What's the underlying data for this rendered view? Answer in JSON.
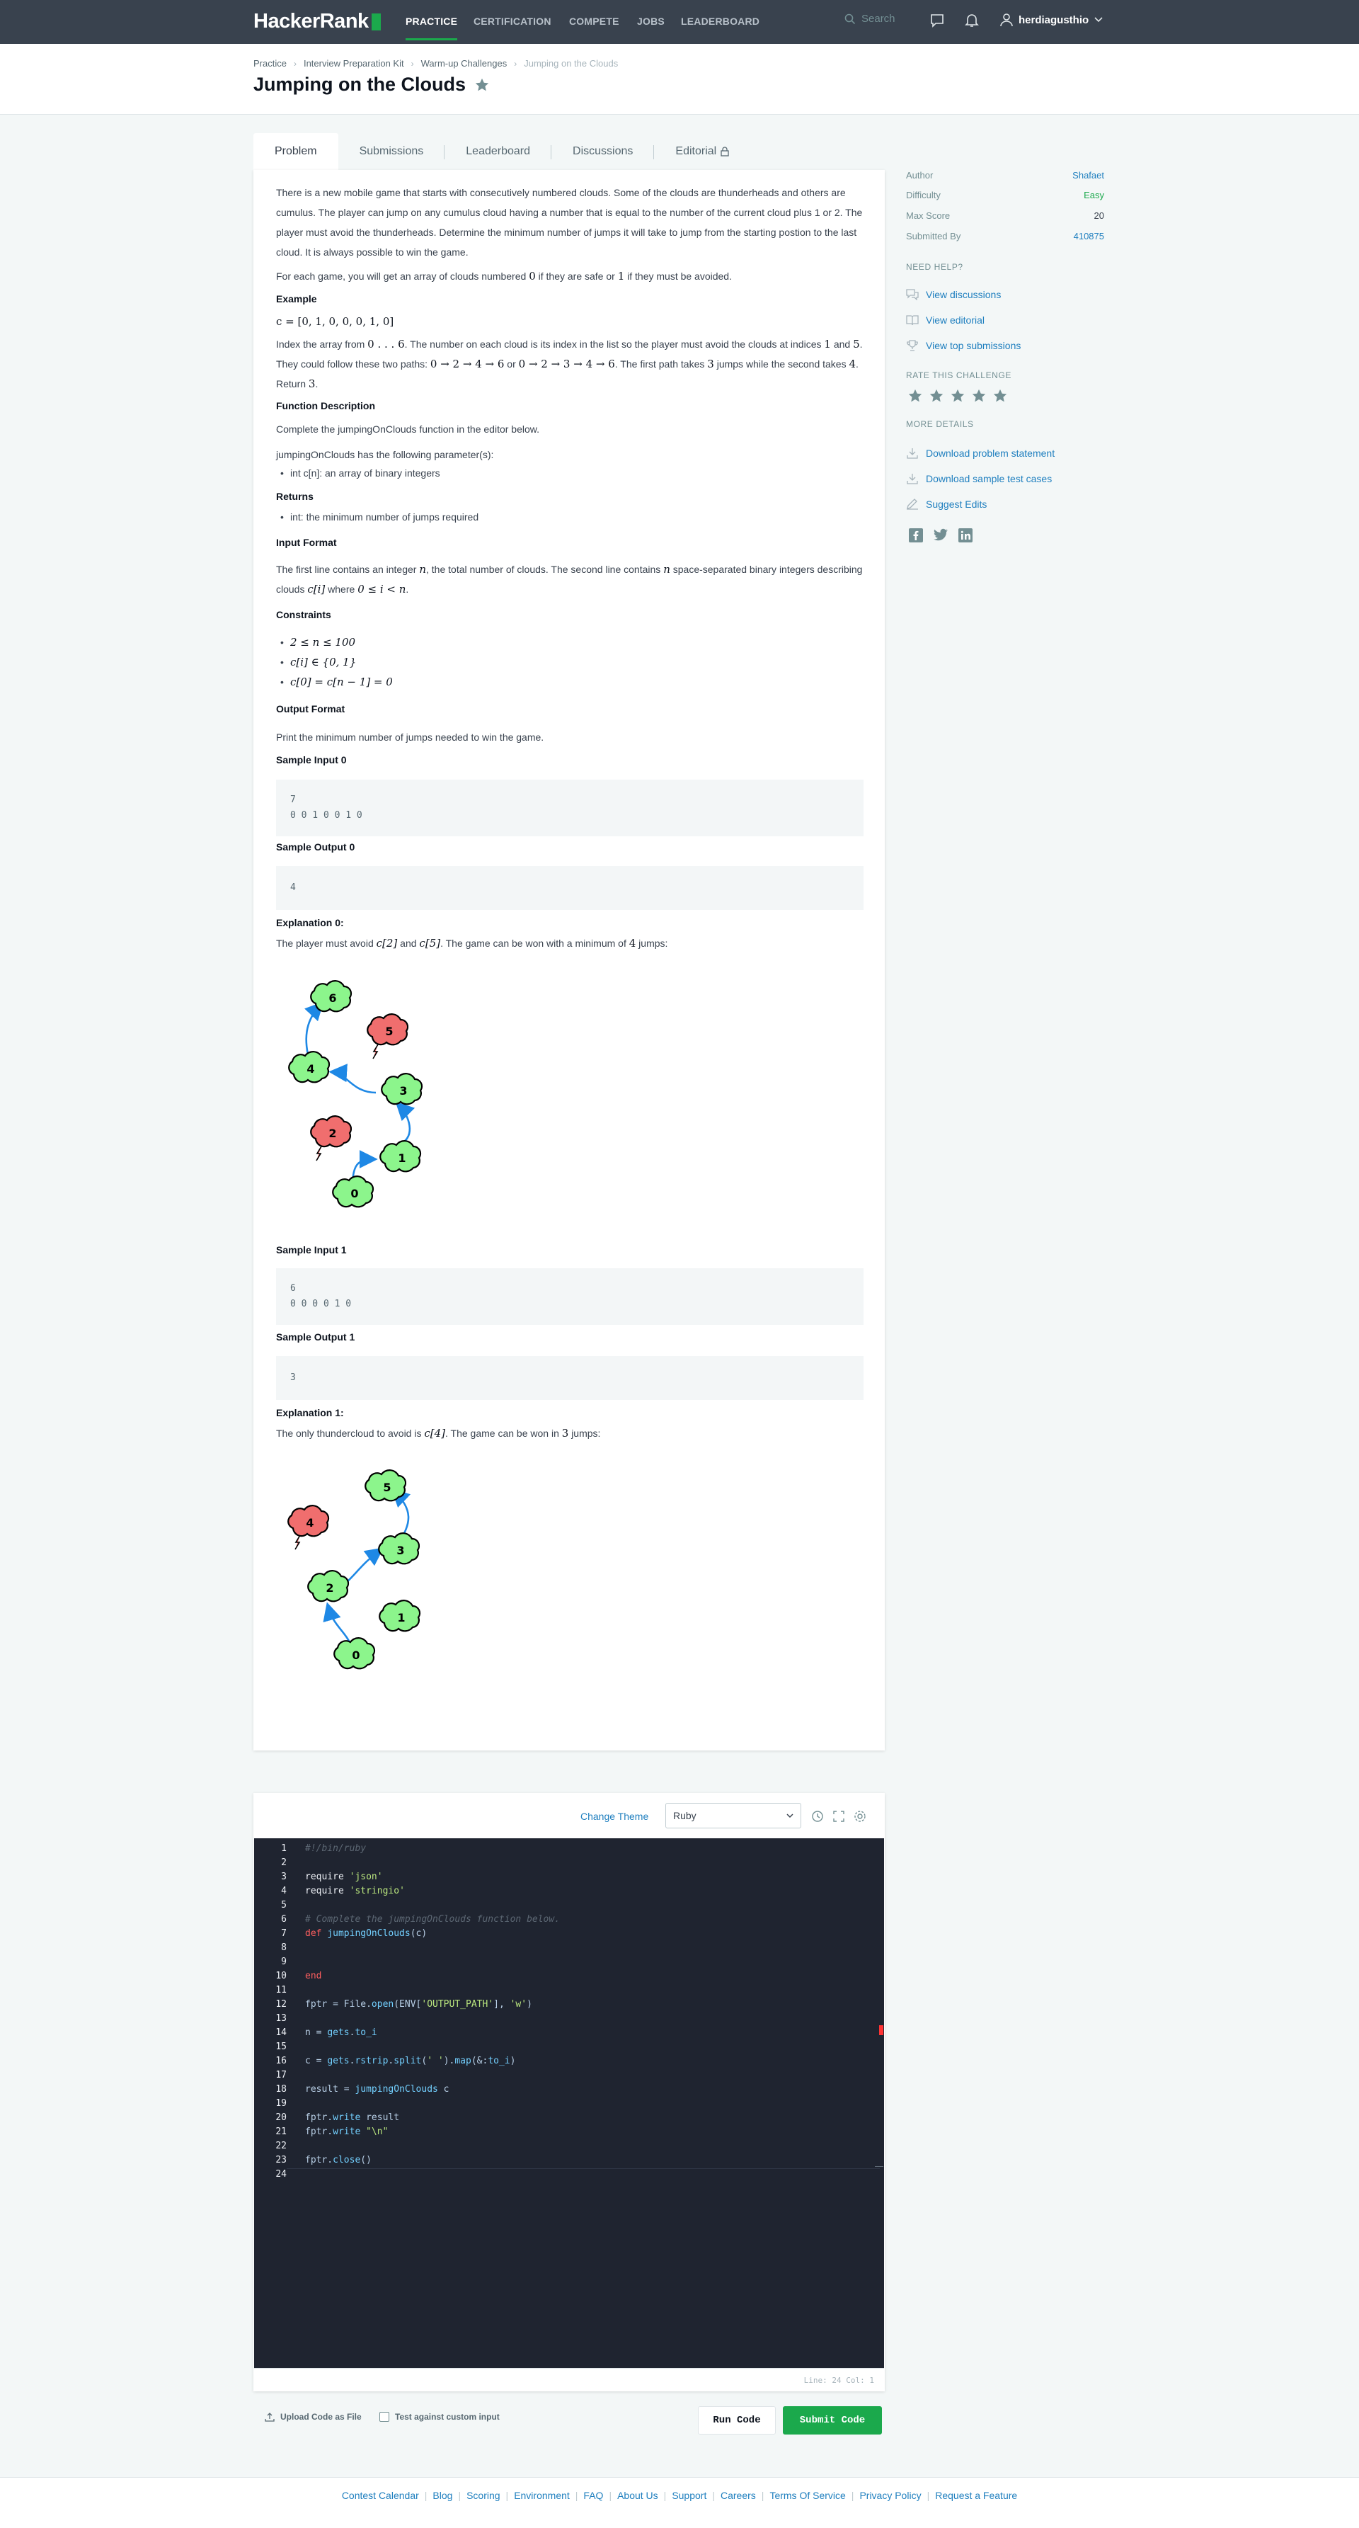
{
  "nav": {
    "logo": "HackerRank",
    "links": [
      "PRACTICE",
      "CERTIFICATION",
      "COMPETE",
      "JOBS",
      "LEADERBOARD"
    ],
    "search_placeholder": "Search",
    "username": "herdiagusthio"
  },
  "breadcrumb": [
    "Practice",
    "Interview Preparation Kit",
    "Warm-up Challenges",
    "Jumping on the Clouds"
  ],
  "title": "Jumping on the Clouds",
  "tabs": [
    "Problem",
    "Submissions",
    "Leaderboard",
    "Discussions",
    "Editorial"
  ],
  "problem": {
    "intro": "There is a new mobile game that starts with consecutively numbered clouds. Some of the clouds are thunderheads and others are cumulus. The player can jump on any cumulus cloud having a number that is equal to the number of the current cloud plus 1 or 2. The player must avoid the thunderheads. Determine the minimum number of jumps it will take to jump from the starting postion to the last cloud. It is always possible to win the game.",
    "each_game_a": "For each game, you will get an array of clouds numbered",
    "each_game_b": "if they are safe or",
    "each_game_c": "if they must be avoided.",
    "example_heading": "Example",
    "example_array": "c = [0, 1, 0, 0, 0, 1, 0]",
    "index_text_a": "Index the array from",
    "index_range": "0 . . . 6",
    "index_text_b": ". The number on each cloud is its index in the list so the player must avoid the clouds at indices",
    "index_text_c": "and",
    "index_text_d": ". They could follow these two paths:",
    "path_1": "0 → 2 → 4 → 6",
    "index_text_e": "or",
    "path_2": "0 → 2 → 3 → 4 → 6",
    "index_text_f": ". The first path takes",
    "index_text_g": "jumps while the second takes",
    "index_text_h": ". Return",
    "func_heading": "Function Description",
    "func_text": "Complete the jumpingOnClouds function in the editor below.",
    "func_params": "jumpingOnClouds has the following parameter(s):",
    "func_param_1": "int c[n]: an array of binary integers",
    "returns_heading": "Returns",
    "returns_1": "int: the minimum number of jumps required",
    "input_heading": "Input Format",
    "input_text_a": "The first line contains an integer",
    "input_text_b": ", the total number of clouds. The second line contains",
    "input_text_c": "space-separated binary integers describing clouds",
    "input_text_d": "where",
    "constraints_heading": "Constraints",
    "constraints": [
      "2 ≤ n ≤ 100",
      "c[i] ∈ {0, 1}",
      "c[0] = c[n − 1] = 0"
    ],
    "output_heading": "Output Format",
    "output_text": "Print the minimum number of jumps needed to win the game.",
    "sample_input_0_heading": "Sample Input 0",
    "sample_input_0": [
      "7",
      "0 0 1 0 0 1 0"
    ],
    "sample_output_0_heading": "Sample Output 0",
    "sample_output_0": "4",
    "explanation_0_heading": "Explanation 0:",
    "explanation_0_a": "The player must avoid",
    "explanation_0_b": "and",
    "explanation_0_c": ". The game can be won with a minimum of",
    "explanation_0_d": "jumps:",
    "sample_input_1_heading": "Sample Input 1",
    "sample_input_1": [
      "6",
      "0 0 0 0 1 0"
    ],
    "sample_output_1_heading": "Sample Output 1",
    "sample_output_1": "3",
    "explanation_1_heading": "Explanation 1:",
    "explanation_1_a": "The only thundercloud to avoid is",
    "explanation_1_b": ". The game can be won in",
    "explanation_1_c": "jumps:",
    "m": {
      "zero": "0",
      "one": "1",
      "two": "2",
      "three": "3",
      "four": "4",
      "five": "5",
      "n": "n",
      "ci": "c[i]",
      "irange": "0 ≤ i < n",
      "c2": "c[2]",
      "c5": "c[5]",
      "c4": "c[4]"
    },
    "diagram_0_clouds": [
      "6",
      "5",
      "4",
      "3",
      "2",
      "1",
      "0"
    ],
    "diagram_1_clouds": [
      "5",
      "4",
      "3",
      "2",
      "1",
      "0"
    ]
  },
  "sidebar": {
    "author_label": "Author",
    "author": "Shafaet",
    "difficulty_label": "Difficulty",
    "difficulty": "Easy",
    "max_score_label": "Max Score",
    "max_score": "20",
    "submitted_label": "Submitted By",
    "submitted": "410875",
    "need_help": "NEED HELP?",
    "help_links": [
      "View discussions",
      "View editorial",
      "View top submissions"
    ],
    "rate": "RATE THIS CHALLENGE",
    "more": "MORE DETAILS",
    "more_links": [
      "Download problem statement",
      "Download sample test cases",
      "Suggest Edits"
    ]
  },
  "editor": {
    "change_theme": "Change Theme",
    "language": "Ruby",
    "status": "Line: 24 Col: 1",
    "lines": [
      "#!/bin/ruby",
      "",
      "require 'json'",
      "require 'stringio'",
      "",
      "# Complete the jumpingOnClouds function below.",
      "def jumpingOnClouds(c)",
      "",
      "",
      "end",
      "",
      "fptr = File.open(ENV['OUTPUT_PATH'], 'w')",
      "",
      "n = gets.to_i",
      "",
      "c = gets.rstrip.split(' ').map(&:to_i)",
      "",
      "result = jumpingOnClouds c",
      "",
      "fptr.write result",
      "fptr.write \"\\n\"",
      "",
      "fptr.close()",
      ""
    ],
    "line_numbers": [
      "1",
      "2",
      "3",
      "4",
      "5",
      "6",
      "7",
      "8",
      "9",
      "10",
      "11",
      "12",
      "13",
      "14",
      "15",
      "16",
      "17",
      "18",
      "19",
      "20",
      "21",
      "22",
      "23",
      "24"
    ]
  },
  "actions": {
    "upload": "Upload Code as File",
    "custom_input": "Test against custom input",
    "run": "Run Code",
    "submit": "Submit Code"
  },
  "footer": [
    "Contest Calendar",
    "Blog",
    "Scoring",
    "Environment",
    "FAQ",
    "About Us",
    "Support",
    "Careers",
    "Terms Of Service",
    "Privacy Policy",
    "Request a Feature"
  ],
  "colors": {
    "accent": "#1ba94c",
    "link": "#1f7fbf",
    "nav_bg": "#39424e",
    "safe_cloud": "#8cf58c",
    "thunder_cloud": "#f06e6e",
    "arrow": "#1e88e5"
  }
}
